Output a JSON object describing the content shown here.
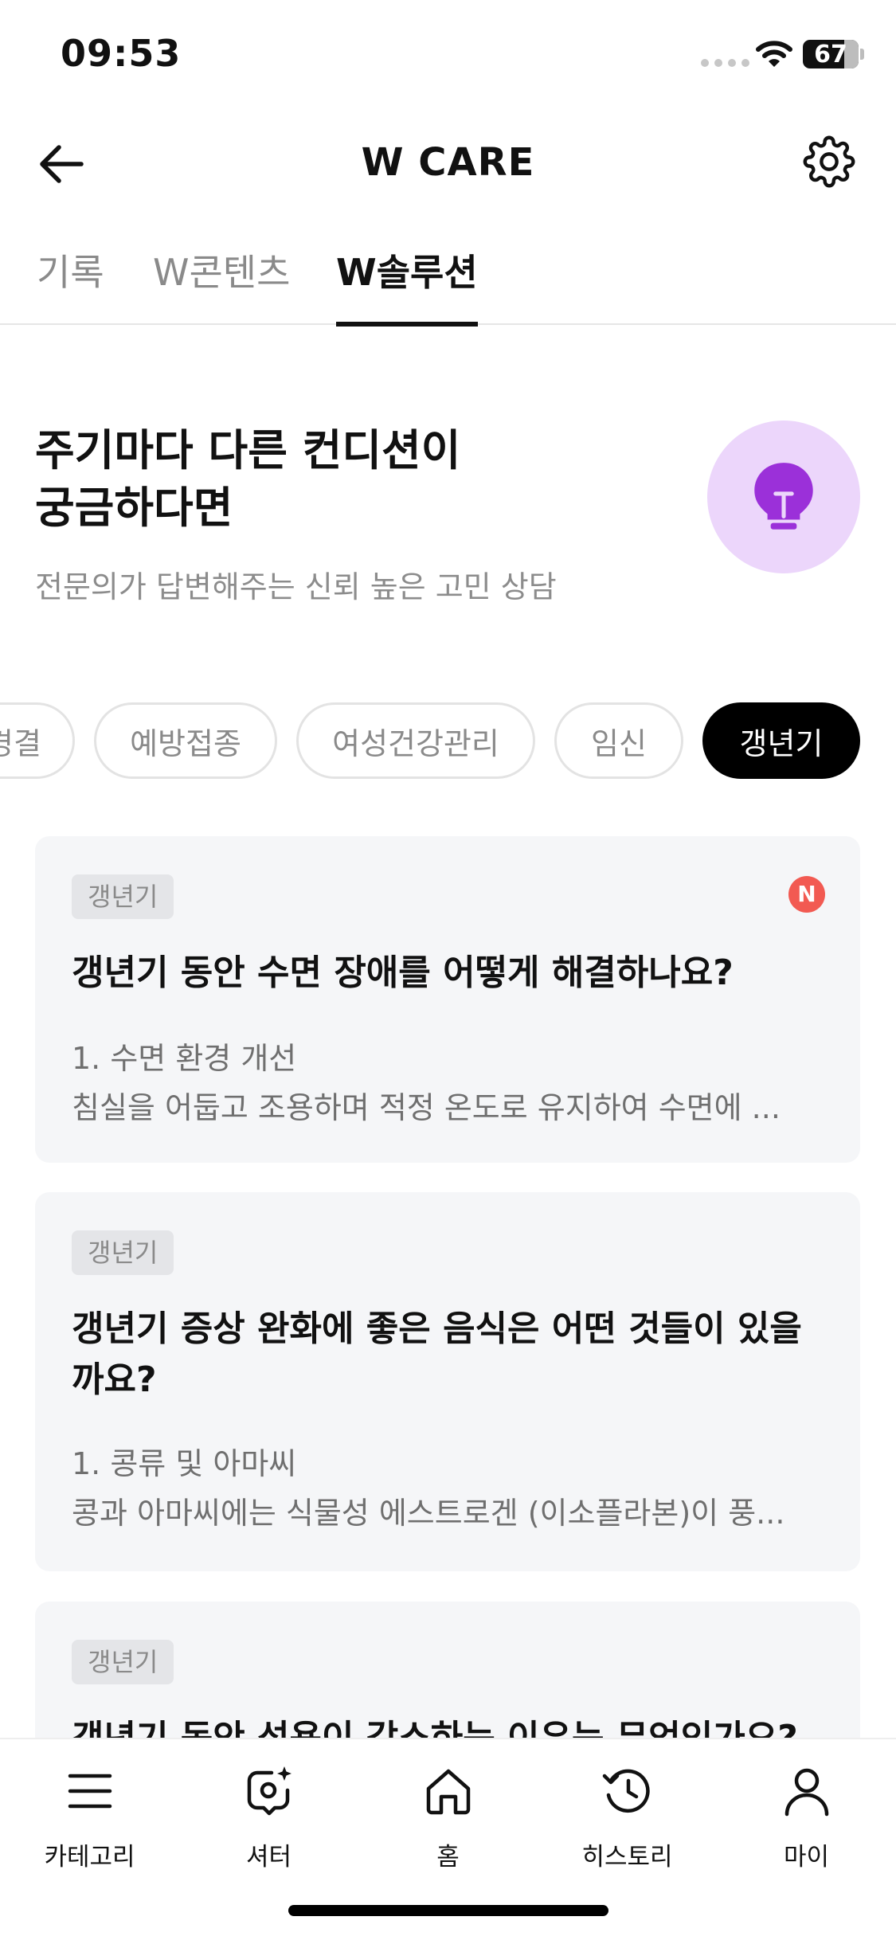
{
  "status_bar": {
    "time": "09:53",
    "battery": "67"
  },
  "header": {
    "title": "W CARE"
  },
  "tabs": [
    {
      "label": "기록",
      "active": false
    },
    {
      "label": "W콘텐츠",
      "active": false
    },
    {
      "label": "W솔루션",
      "active": true
    }
  ],
  "hero": {
    "title_line1": "주기마다 다른 컨디션이",
    "title_line2": "궁금하다면",
    "subtitle": "전문의가 답변해주는 신뢰 높은 고민 상담",
    "accent_color": "#9b30d9"
  },
  "categories": [
    {
      "label": "경결",
      "active": false
    },
    {
      "label": "예방접종",
      "active": false
    },
    {
      "label": "여성건강관리",
      "active": false
    },
    {
      "label": "임신",
      "active": false
    },
    {
      "label": "갱년기",
      "active": true
    }
  ],
  "cards": [
    {
      "tag": "갱년기",
      "new_badge": "N",
      "title_line1": "갱년기 동안 수면 장애를 어떻게 해결하나요?",
      "title_line2": "",
      "preview_line1": "1. 수면 환경 개선",
      "preview_line2": "침실을 어둡고 조용하며 적정 온도로 유지하여 수면에 ..."
    },
    {
      "tag": "갱년기",
      "new_badge": "",
      "title_line1": "갱년기 증상 완화에 좋은 음식은 어떤 것들이 있을",
      "title_line2": "까요?",
      "preview_line1": "1. 콩류 및 아마씨",
      "preview_line2": "콩과 아마씨에는 식물성 에스트로겐 (이소플라본)이 풍..."
    },
    {
      "tag": "갱년기",
      "new_badge": "",
      "title_line1": "갱년기 동안 성욕이 감소하는 이유는 무엇인가요?",
      "title_line2": "",
      "preview_line1": "",
      "preview_line2": ""
    }
  ],
  "bottom_nav": [
    {
      "label": "카테고리",
      "icon": "menu-icon"
    },
    {
      "label": "셔터",
      "icon": "shutter-icon"
    },
    {
      "label": "홈",
      "icon": "home-icon"
    },
    {
      "label": "히스토리",
      "icon": "history-icon"
    },
    {
      "label": "마이",
      "icon": "person-icon"
    }
  ],
  "colors": {
    "new_badge": "#f25a52",
    "hero_circle": "#ecd6fb",
    "card_bg": "#f5f6f8",
    "active_chip": "#000000"
  }
}
